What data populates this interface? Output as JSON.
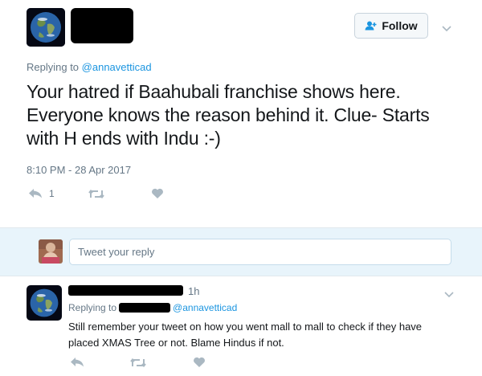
{
  "tweet": {
    "follow_label": "Follow",
    "replying_prefix": "Replying to",
    "replying_handle": "@annavetticad",
    "text": "Your hatred if Baahubali franchise shows here. Everyone knows the reason behind it.  Clue- Starts with H ends with Indu :-)",
    "timestamp": "8:10 PM - 28 Apr 2017",
    "reply_count": "1"
  },
  "reply_box": {
    "placeholder": "Tweet your reply"
  },
  "reply_tweet": {
    "time": "1h",
    "replying_prefix": "Replying to",
    "replying_handle": "@annavetticad",
    "text": "Still remember your tweet on how you went mall to mall to check if they have placed XMAS Tree or not. Blame Hindus if not."
  },
  "colors": {
    "accent": "#1b95e0",
    "muted": "#657786",
    "reply_bar": "#e8f4fb"
  }
}
